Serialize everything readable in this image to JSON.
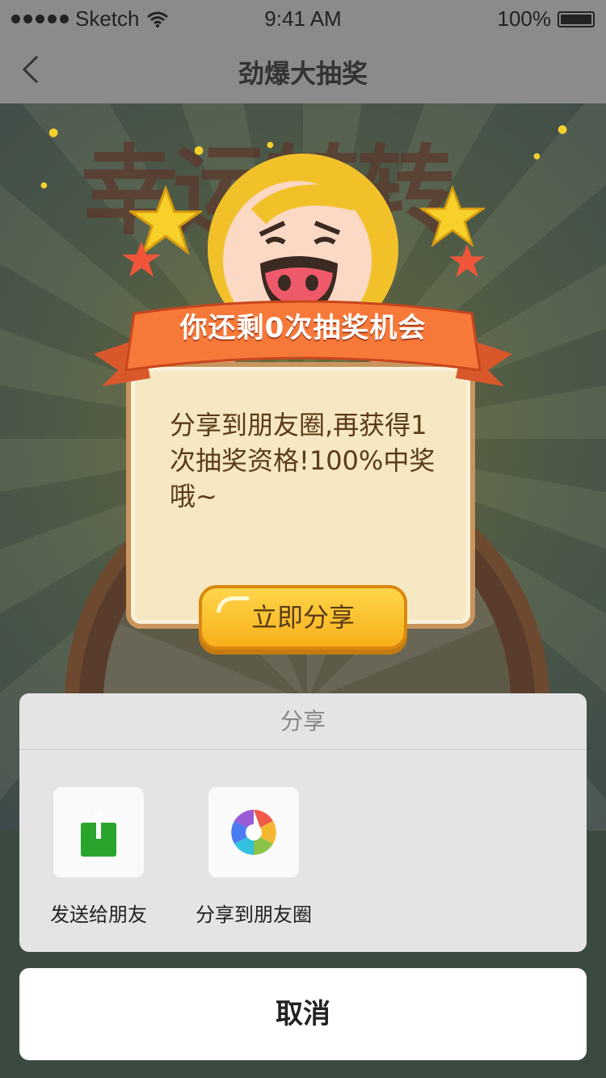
{
  "status_bar": {
    "carrier": "Sketch",
    "time": "9:41 AM",
    "battery": "100%"
  },
  "nav": {
    "title": "劲爆大抽奖",
    "back_icon": "chevron-left-icon"
  },
  "popup": {
    "banner_text": "你还剩0次抽奖机会",
    "message": "分享到朋友圈,再获得1次抽奖资格!100%中奖哦~",
    "share_button": "立即分享"
  },
  "action_sheet": {
    "title": "分享",
    "options": [
      {
        "label": "发送给朋友",
        "icon": "share-upload-icon",
        "color": "#2aa52c"
      },
      {
        "label": "分享到朋友圈",
        "icon": "moments-aperture-icon"
      }
    ],
    "cancel": "取消"
  }
}
